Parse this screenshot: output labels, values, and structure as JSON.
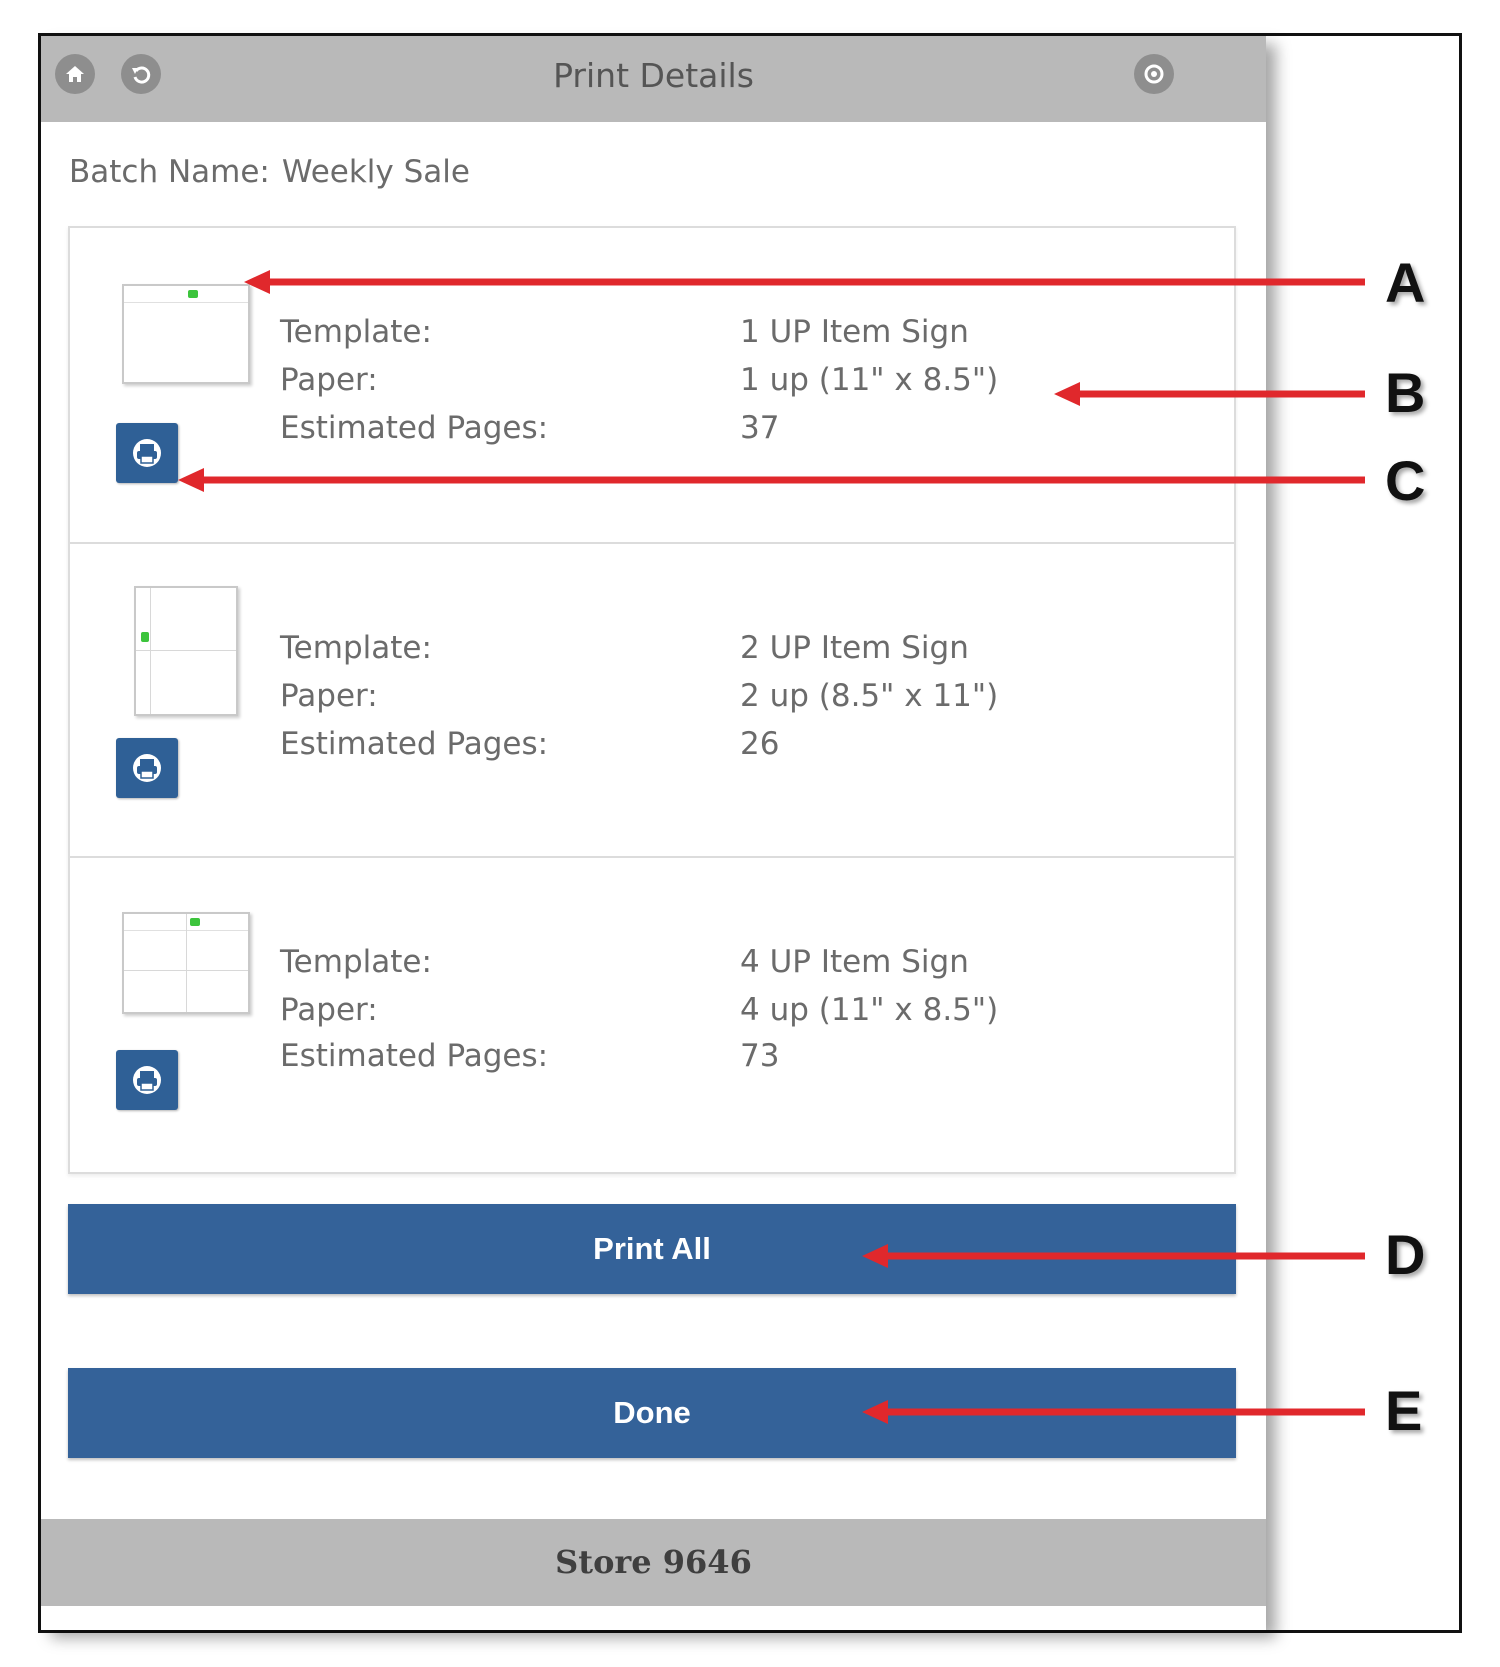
{
  "header": {
    "title": "Print Details",
    "left_icons": [
      "home-icon",
      "back-icon"
    ],
    "right_icon": "settings-icon"
  },
  "batch": {
    "label": "Batch Name:",
    "value": "Weekly Sale"
  },
  "field_labels": {
    "template": "Template:",
    "paper": "Paper:",
    "pages": "Estimated Pages:"
  },
  "items": [
    {
      "template": "1 UP Item Sign",
      "paper": "1 up (11\" x 8.5\")",
      "pages": "37"
    },
    {
      "template": "2 UP Item Sign",
      "paper": "2 up (8.5\" x 11\")",
      "pages": "26"
    },
    {
      "template": "4 UP Item Sign",
      "paper": "4 up (11\" x 8.5\")",
      "pages": "73"
    }
  ],
  "buttons": {
    "print_all": "Print All",
    "done": "Done"
  },
  "footer": {
    "store": "Store 9646"
  },
  "callouts": [
    "A",
    "B",
    "C",
    "D",
    "E"
  ],
  "colors": {
    "accent": "#346299",
    "header_bg": "#b9b9b9",
    "arrow": "#e0282c",
    "thumb_marker": "#3cc43c"
  }
}
